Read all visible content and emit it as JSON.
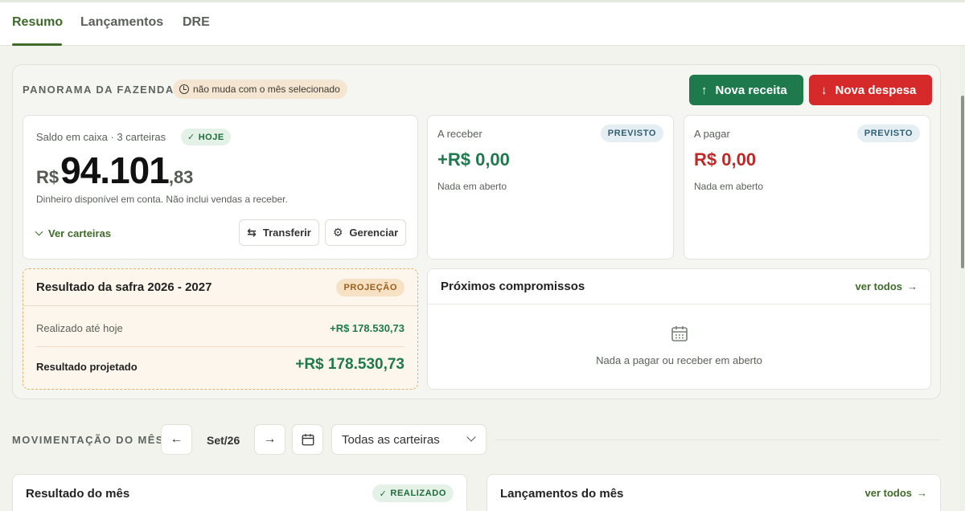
{
  "tabs": [
    {
      "label": "Resumo",
      "active": true
    },
    {
      "label": "Lançamentos",
      "active": false
    },
    {
      "label": "DRE",
      "active": false
    }
  ],
  "panorama": {
    "title": "PANORAMA DA FAZENDA",
    "info_chip": "não muda com o mês selecionado",
    "btn_receita": "Nova receita",
    "btn_despesa": "Nova despesa"
  },
  "saldo": {
    "label": "Saldo em caixa · 3 carteiras",
    "badge": "HOJE",
    "currency": "R$",
    "integer": "94.101",
    "cents": ",83",
    "note": "Dinheiro disponível em conta. Não inclui vendas a receber.",
    "ver_carteiras": "Ver carteiras",
    "transferir": "Transferir",
    "gerenciar": "Gerenciar"
  },
  "receber": {
    "label": "A receber",
    "badge": "PREVISTO",
    "value": "+R$ 0,00",
    "sub": "Nada em aberto"
  },
  "pagar": {
    "label": "A pagar",
    "badge": "PREVISTO",
    "value": "R$ 0,00",
    "sub": "Nada em aberto"
  },
  "safra": {
    "title": "Resultado da safra 2026 - 2027",
    "badge": "PROJEÇÃO",
    "realizado_label": "Realizado até hoje",
    "realizado_value": "+R$ 178.530,73",
    "projetado_label": "Resultado projetado",
    "projetado_value": "+R$ 178.530,73"
  },
  "proximos": {
    "title": "Próximos compromissos",
    "link": "ver todos",
    "empty": "Nada a pagar ou receber em aberto"
  },
  "movimentacao": {
    "title": "MOVIMENTAÇÃO DO MÊS",
    "month": "Set/26",
    "wallet_select": "Todas as carteiras"
  },
  "resultado_mes": {
    "title": "Resultado do mês",
    "badge": "REALIZADO"
  },
  "lancamentos_mes": {
    "title": "Lançamentos do mês",
    "link": "ver todos"
  },
  "colors": {
    "brand_green": "#3f6a2a",
    "positive": "#1e7a4c",
    "negative": "#c02828",
    "danger_button": "#d62a2a"
  }
}
